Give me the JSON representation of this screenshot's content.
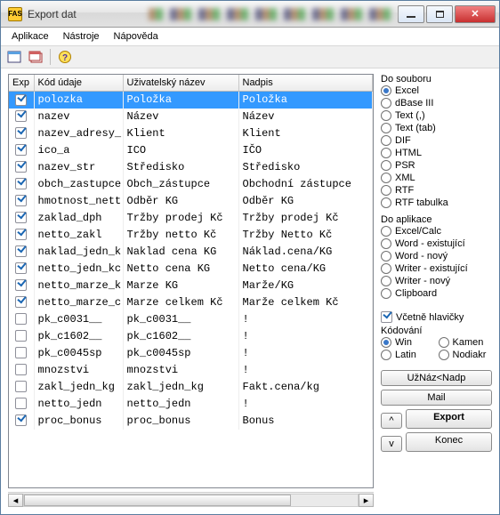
{
  "window": {
    "title": "Export dat",
    "app_icon_text": "FAS"
  },
  "menu": {
    "aplikace": "Aplikace",
    "nastroje": "Nástroje",
    "napoveda": "Nápověda"
  },
  "toolbar": {
    "icons": [
      "card-icon",
      "cards-icon",
      "help-icon"
    ]
  },
  "grid": {
    "headers": {
      "exp": "Exp",
      "kod": "Kód údaje",
      "uziv": "Uživatelský název",
      "nadpis": "Nadpis"
    },
    "rows": [
      {
        "exp": true,
        "kod": "polozka",
        "uziv": "Položka",
        "nadpis": "Položka",
        "sel": true
      },
      {
        "exp": true,
        "kod": "nazev",
        "uziv": "Název",
        "nadpis": "Název"
      },
      {
        "exp": true,
        "kod": "nazev_adresy_",
        "uziv": "Klient",
        "nadpis": "Klient"
      },
      {
        "exp": true,
        "kod": "ico_a",
        "uziv": "ICO",
        "nadpis": "IČO"
      },
      {
        "exp": true,
        "kod": "nazev_str",
        "uziv": "Středisko",
        "nadpis": "Středisko"
      },
      {
        "exp": true,
        "kod": "obch_zastupce",
        "uziv": "Obch_zástupce",
        "nadpis": "Obchodní zástupce"
      },
      {
        "exp": true,
        "kod": "hmotnost_nett",
        "uziv": "Odběr KG",
        "nadpis": "Odběr KG"
      },
      {
        "exp": true,
        "kod": "zaklad_dph",
        "uziv": "Tržby prodej Kč",
        "nadpis": "Tržby prodej Kč"
      },
      {
        "exp": true,
        "kod": "netto_zakl",
        "uziv": "Tržby netto Kč",
        "nadpis": "Tržby Netto Kč"
      },
      {
        "exp": true,
        "kod": "naklad_jedn_k",
        "uziv": "Naklad cena KG",
        "nadpis": "Náklad.cena/KG"
      },
      {
        "exp": true,
        "kod": "netto_jedn_kc",
        "uziv": "Netto cena KG",
        "nadpis": "Netto cena/KG"
      },
      {
        "exp": true,
        "kod": "netto_marze_k",
        "uziv": "Marze KG",
        "nadpis": "Marže/KG"
      },
      {
        "exp": true,
        "kod": "netto_marze_c",
        "uziv": "Marze celkem Kč",
        "nadpis": "Marže celkem Kč"
      },
      {
        "exp": false,
        "kod": "pk_c0031__",
        "uziv": "pk_c0031__",
        "nadpis": "!"
      },
      {
        "exp": false,
        "kod": "pk_c1602__",
        "uziv": "pk_c1602__",
        "nadpis": "!"
      },
      {
        "exp": false,
        "kod": "pk_c0045sp",
        "uziv": "pk_c0045sp",
        "nadpis": "!"
      },
      {
        "exp": false,
        "kod": "mnozstvi",
        "uziv": "mnozstvi",
        "nadpis": "!"
      },
      {
        "exp": false,
        "kod": "zakl_jedn_kg",
        "uziv": "zakl_jedn_kg",
        "nadpis": "Fakt.cena/kg"
      },
      {
        "exp": false,
        "kod": "netto_jedn",
        "uziv": "netto_jedn",
        "nadpis": "!"
      },
      {
        "exp": true,
        "kod": "proc_bonus",
        "uziv": "proc_bonus",
        "nadpis": "Bonus"
      }
    ]
  },
  "side": {
    "to_file": {
      "title": "Do souboru",
      "items": [
        "Excel",
        "dBase III",
        "Text (,)",
        "Text (tab)",
        "DIF",
        "HTML",
        "PSR",
        "XML",
        "RTF",
        "RTF tabulka"
      ],
      "selected": 0
    },
    "to_app": {
      "title": "Do aplikace",
      "items": [
        "Excel/Calc",
        "Word - existující",
        "Word - nový",
        "Writer - existující",
        "Writer - nový",
        "Clipboard"
      ]
    },
    "include_header": {
      "label": "Včetně hlavičky",
      "checked": true
    },
    "encoding": {
      "title": "Kódování",
      "items": [
        "Win",
        "Kamen",
        "Latin",
        "Nodiakr"
      ],
      "selected": 0
    },
    "btn_uznaz": "UžNáz<Nadp",
    "btn_mail": "Mail",
    "btn_export": "Export",
    "btn_konec": "Konec",
    "btn_up": "^",
    "btn_down": "v"
  }
}
